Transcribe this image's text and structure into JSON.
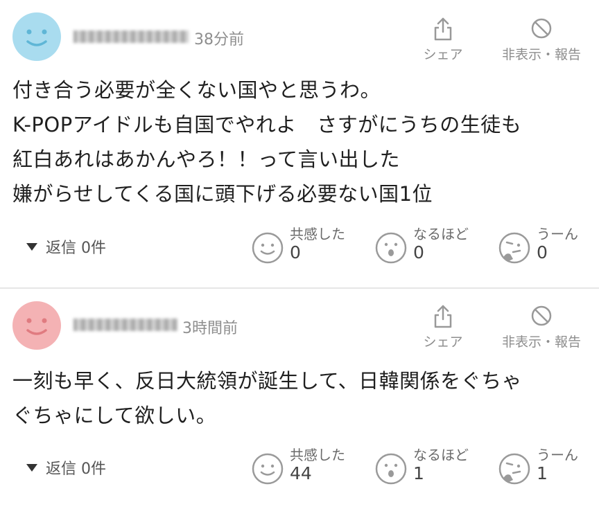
{
  "comments": [
    {
      "time": "38分前",
      "avatar_color": "#a9dcef",
      "share_label": "シェア",
      "hide_label": "非表示・報告",
      "body": "付き合う必要が全くない国やと思うわ。\nK-POPアイドルも自国でやれよ　さすがにうちの生徒も\n紅白あれはあかんやろ！！って言い出した\n嫌がらせしてくる国に頭下げる必要ない国1位",
      "reply_label": "返信 0件",
      "reactions": [
        {
          "label": "共感した",
          "count": "0"
        },
        {
          "label": "なるほど",
          "count": "0"
        },
        {
          "label": "うーん",
          "count": "0"
        }
      ]
    },
    {
      "time": "3時間前",
      "avatar_color": "#f4b2b4",
      "share_label": "シェア",
      "hide_label": "非表示・報告",
      "body": "一刻も早く、反日大統領が誕生して、日韓関係をぐちゃ\nぐちゃにして欲しい。",
      "reply_label": "返信 0件",
      "reactions": [
        {
          "label": "共感した",
          "count": "44"
        },
        {
          "label": "なるほど",
          "count": "1"
        },
        {
          "label": "うーん",
          "count": "1"
        }
      ]
    }
  ],
  "icons": {
    "share": "share-icon",
    "hide": "block-icon",
    "empathy": "smile-face-icon",
    "understand": "surprised-face-icon",
    "hmm": "thinking-face-icon"
  },
  "colors": {
    "muted_text": "#8e8e8e",
    "icon_gray": "#9a9a9a",
    "divider": "#e6e6e6"
  }
}
